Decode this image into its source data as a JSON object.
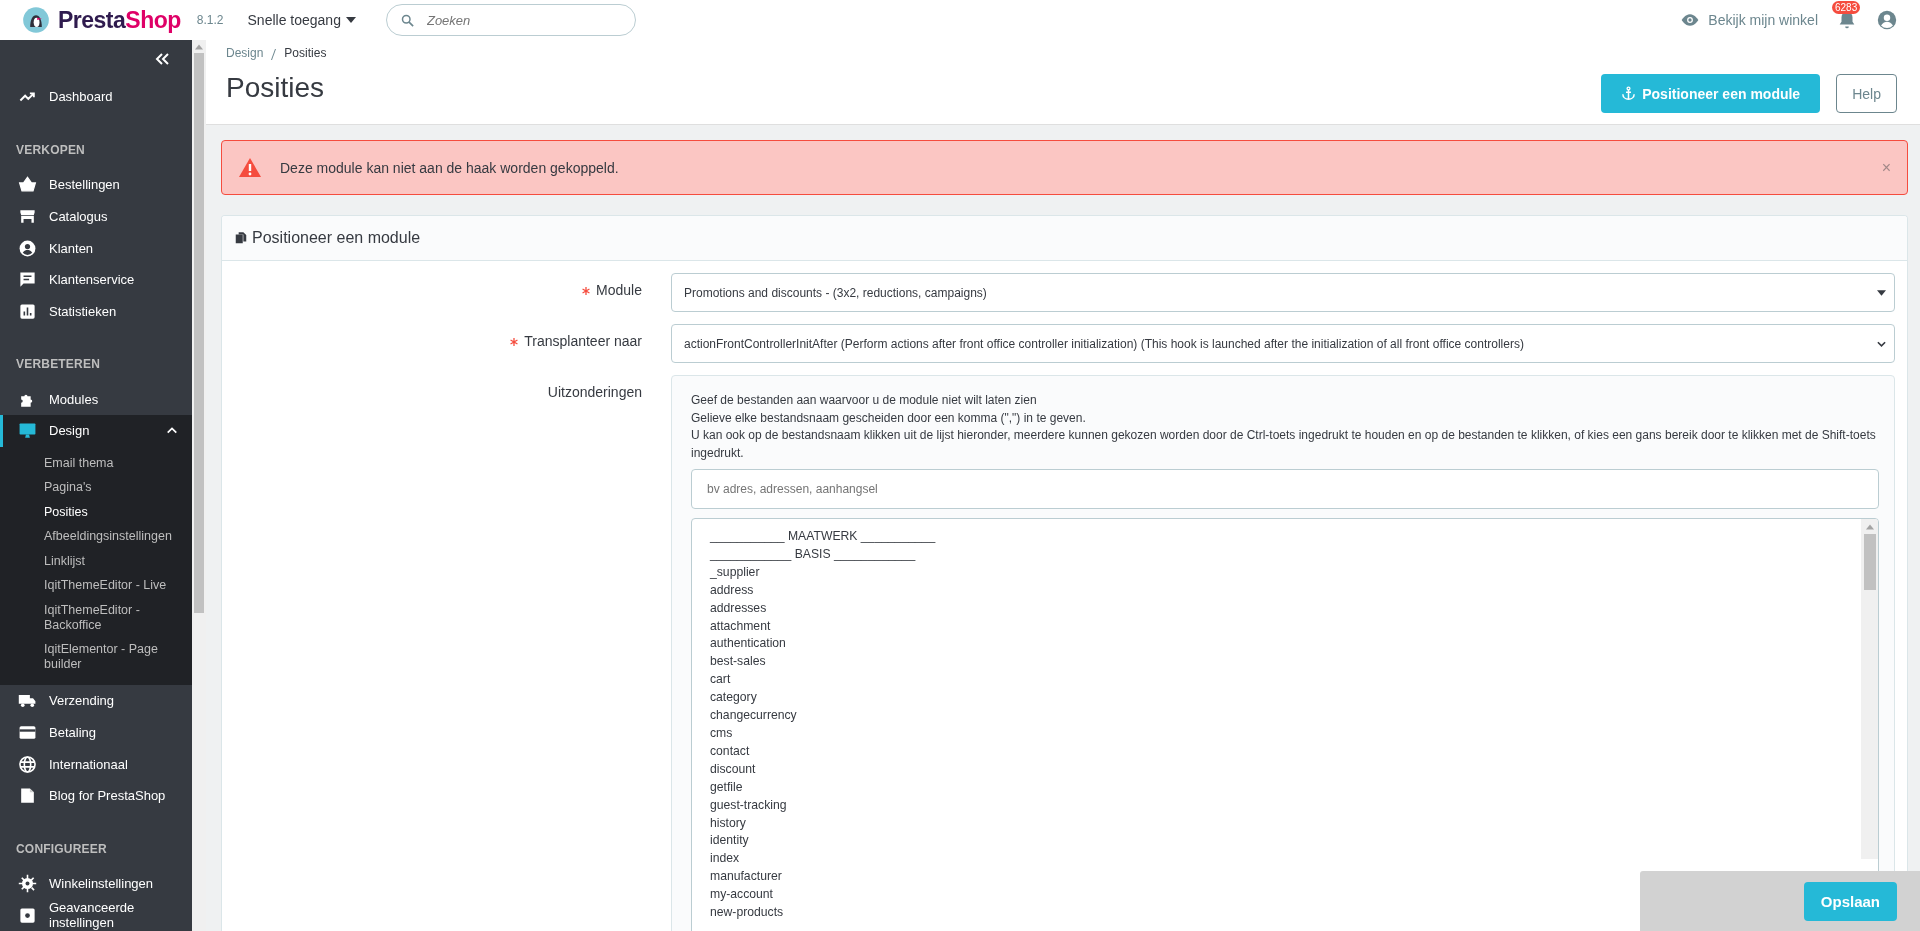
{
  "header": {
    "logo": [
      "Presta",
      "Shop"
    ],
    "version": "8.1.2",
    "quick_access": "Snelle toegang",
    "search": {
      "placeholder": "Zoeken"
    },
    "view_shop": "Bekijk mijn winkel",
    "notifications": "6283"
  },
  "sidebar": {
    "sections": [
      {
        "items": [
          {
            "label": "Dashboard",
            "selected": false
          }
        ]
      },
      {
        "title": "VERKOPEN",
        "items": [
          {
            "label": "Bestellingen",
            "selected": false
          },
          {
            "label": "Catalogus",
            "selected": false
          },
          {
            "label": "Klanten",
            "selected": false
          },
          {
            "label": "Klantenservice",
            "selected": false
          },
          {
            "label": "Statistieken",
            "selected": false
          }
        ]
      },
      {
        "title": "VERBETEREN",
        "items": [
          {
            "label": "Modules",
            "selected": false
          },
          {
            "label": "Design",
            "selected": true,
            "expanded": true,
            "children": [
              {
                "label": "Email thema",
                "selected": false
              },
              {
                "label": "Pagina's",
                "selected": false
              },
              {
                "label": "Posities",
                "selected": true
              },
              {
                "label": "Afbeeldingsinstellingen",
                "selected": false
              },
              {
                "label": "Linklijst",
                "selected": false
              },
              {
                "label": "IqitThemeEditor - Live",
                "selected": false
              },
              {
                "label": "IqitThemeEditor - Backoffice",
                "selected": false
              },
              {
                "label": "IqitElementor - Page builder",
                "selected": false
              }
            ]
          },
          {
            "label": "Verzending",
            "selected": false
          },
          {
            "label": "Betaling",
            "selected": false
          },
          {
            "label": "Internationaal",
            "selected": false
          },
          {
            "label": "Blog for PrestaShop",
            "selected": false
          }
        ]
      },
      {
        "title": "CONFIGUREER",
        "items": [
          {
            "label": "Winkelinstellingen",
            "selected": false
          },
          {
            "label": "Geavanceerde instellingen",
            "selected": false
          }
        ]
      }
    ]
  },
  "page": {
    "breadcrumb": [
      "Design",
      "Posities"
    ],
    "title": "Posities",
    "actions": [
      {
        "kind": "primary",
        "label": "Positioneer een module"
      },
      {
        "kind": "secondary",
        "label": "Help"
      }
    ]
  },
  "alert": {
    "message": "Deze module kan niet aan de haak worden gekoppeld.",
    "close": "×"
  },
  "card": {
    "title": "Positioneer een module",
    "fields": [
      {
        "kind": "select",
        "label": "Module",
        "required": true,
        "value": "Promotions and discounts - (3x2, reductions, campaigns)"
      },
      {
        "kind": "select",
        "label": "Transplanteer naar",
        "required": true,
        "value": "actionFrontControllerInitAfter (Perform actions after front office controller initialization) (This hook is launched after the initialization of all front office controllers)"
      },
      {
        "kind": "exceptions",
        "label": "Uitzonderingen",
        "required": false,
        "help": [
          "Geef de bestanden aan waarvoor u de module niet wilt laten zien",
          "Gelieve elke bestandsnaam gescheiden door een komma (\",\") in te geven.",
          "U kan ook op de bestandsnaam klikken uit de lijst hieronder, meerdere kunnen gekozen worden door de Ctrl-toets ingedrukt te houden en op de bestanden te klikken, of kies een gans bereik door te klikken met de Shift-toets ingedrukt."
        ],
        "placeholder": "bv adres, adressen, aanhangsel",
        "options": [
          {
            "label": "___________ MAATWERK ___________",
            "selected": false
          },
          {
            "label": "____________ BASIS ____________",
            "selected": false
          },
          {
            "label": "_supplier",
            "selected": false
          },
          {
            "label": "address",
            "selected": false
          },
          {
            "label": "addresses",
            "selected": false
          },
          {
            "label": "attachment",
            "selected": false
          },
          {
            "label": "authentication",
            "selected": false
          },
          {
            "label": "best-sales",
            "selected": false
          },
          {
            "label": "cart",
            "selected": false
          },
          {
            "label": "category",
            "selected": false
          },
          {
            "label": "changecurrency",
            "selected": false
          },
          {
            "label": "cms",
            "selected": false
          },
          {
            "label": "contact",
            "selected": false
          },
          {
            "label": "discount",
            "selected": false
          },
          {
            "label": "getfile",
            "selected": false
          },
          {
            "label": "guest-tracking",
            "selected": false
          },
          {
            "label": "history",
            "selected": false
          },
          {
            "label": "identity",
            "selected": false
          },
          {
            "label": "index",
            "selected": false
          },
          {
            "label": "manufacturer",
            "selected": false
          },
          {
            "label": "my-account",
            "selected": false
          },
          {
            "label": "new-products",
            "selected": false
          }
        ]
      }
    ]
  },
  "save_button": "Opslaan"
}
